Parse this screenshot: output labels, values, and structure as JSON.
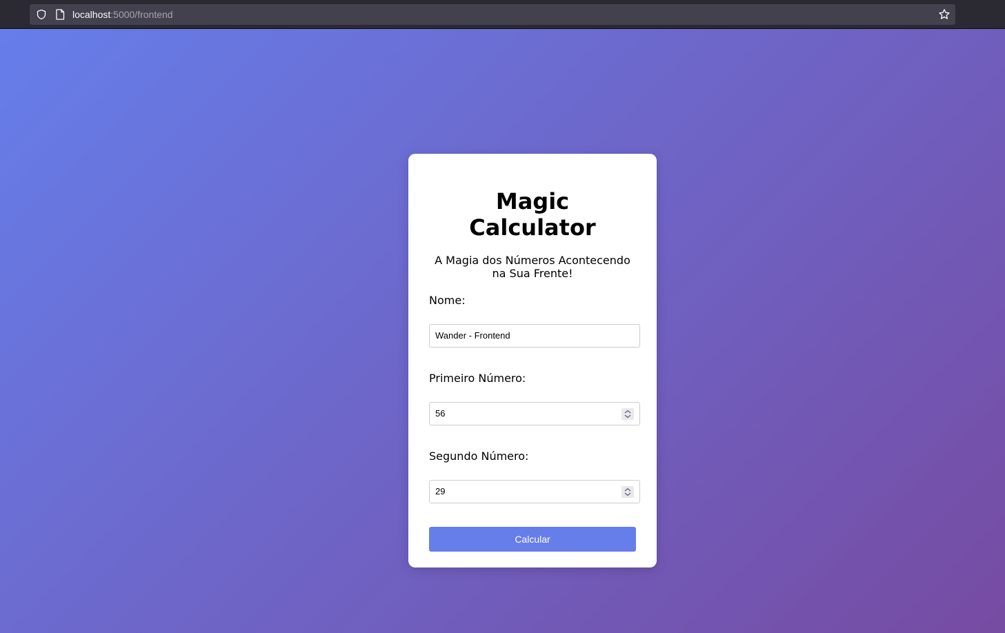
{
  "browser": {
    "url_host": "localhost",
    "url_rest": ":5000/frontend"
  },
  "page": {
    "background_colors": [
      "#667eea",
      "#764ba2"
    ],
    "title": "Magic Calculator",
    "subtitle": "A Magia dos Números Acontecendo na Sua Frente!",
    "form": {
      "name_label": "Nome:",
      "name_value": "Wander - Frontend",
      "first_label": "Primeiro Número:",
      "first_value": "56",
      "second_label": "Segundo Número:",
      "second_value": "29",
      "submit_label": "Calcular",
      "accent_color": "#667eea"
    }
  },
  "icons": {
    "shield": "shield-icon",
    "page": "page-icon",
    "star": "bookmark-star-icon",
    "spinner": "spinner-arrows-icon"
  }
}
